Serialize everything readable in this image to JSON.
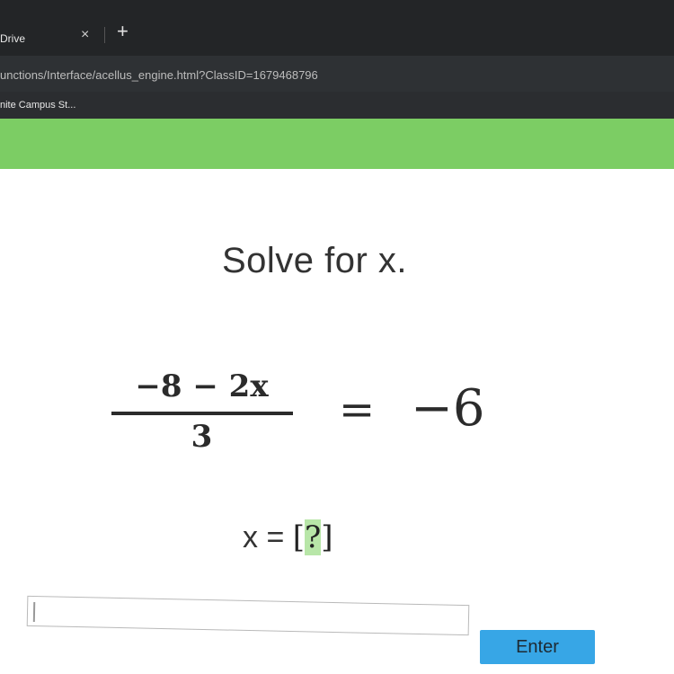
{
  "browser": {
    "tab_title": "Drive",
    "tab_close": "×",
    "new_tab": "+",
    "url": "unctions/Interface/acellus_engine.html?ClassID=1679468796",
    "bookmark": "nite Campus St..."
  },
  "problem": {
    "prompt": "Solve for x.",
    "numerator": "−8 − 2x",
    "denominator": "3",
    "equals": "=",
    "rhs": "−6",
    "answer_var": "x = ",
    "answer_open": "[",
    "answer_placeholder": "?",
    "answer_close": "]"
  },
  "controls": {
    "answer_value": "",
    "enter_label": "Enter"
  },
  "colors": {
    "accent_green": "#7ccd64",
    "button_blue": "#37a6e6"
  }
}
